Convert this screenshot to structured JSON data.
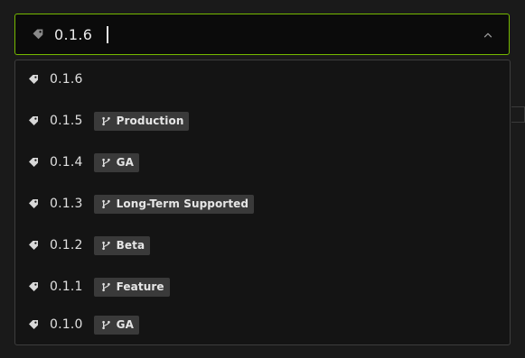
{
  "version_select": {
    "selected_value": "0.1.6",
    "icon": "tag-icon",
    "toggle_icon": "chevron-up-icon",
    "accent_color": "#76b900",
    "options": [
      {
        "label": "0.1.6",
        "badge": null
      },
      {
        "label": "0.1.5",
        "badge": "Production"
      },
      {
        "label": "0.1.4",
        "badge": "GA"
      },
      {
        "label": "0.1.3",
        "badge": "Long-Term Supported"
      },
      {
        "label": "0.1.2",
        "badge": "Beta"
      },
      {
        "label": "0.1.1",
        "badge": "Feature"
      },
      {
        "label": "0.1.0",
        "badge": "GA"
      }
    ],
    "badge_icon": "branch-icon"
  }
}
